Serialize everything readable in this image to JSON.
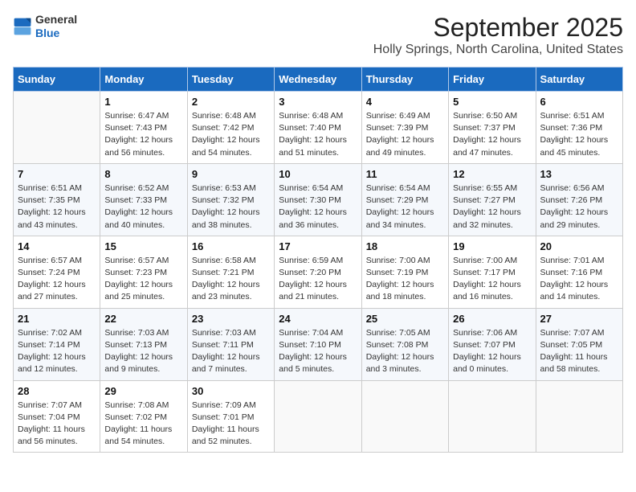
{
  "header": {
    "logo_line1": "General",
    "logo_line2": "Blue",
    "month": "September 2025",
    "location": "Holly Springs, North Carolina, United States"
  },
  "weekdays": [
    "Sunday",
    "Monday",
    "Tuesday",
    "Wednesday",
    "Thursday",
    "Friday",
    "Saturday"
  ],
  "weeks": [
    [
      {
        "day": "",
        "info": ""
      },
      {
        "day": "1",
        "info": "Sunrise: 6:47 AM\nSunset: 7:43 PM\nDaylight: 12 hours\nand 56 minutes."
      },
      {
        "day": "2",
        "info": "Sunrise: 6:48 AM\nSunset: 7:42 PM\nDaylight: 12 hours\nand 54 minutes."
      },
      {
        "day": "3",
        "info": "Sunrise: 6:48 AM\nSunset: 7:40 PM\nDaylight: 12 hours\nand 51 minutes."
      },
      {
        "day": "4",
        "info": "Sunrise: 6:49 AM\nSunset: 7:39 PM\nDaylight: 12 hours\nand 49 minutes."
      },
      {
        "day": "5",
        "info": "Sunrise: 6:50 AM\nSunset: 7:37 PM\nDaylight: 12 hours\nand 47 minutes."
      },
      {
        "day": "6",
        "info": "Sunrise: 6:51 AM\nSunset: 7:36 PM\nDaylight: 12 hours\nand 45 minutes."
      }
    ],
    [
      {
        "day": "7",
        "info": "Sunrise: 6:51 AM\nSunset: 7:35 PM\nDaylight: 12 hours\nand 43 minutes."
      },
      {
        "day": "8",
        "info": "Sunrise: 6:52 AM\nSunset: 7:33 PM\nDaylight: 12 hours\nand 40 minutes."
      },
      {
        "day": "9",
        "info": "Sunrise: 6:53 AM\nSunset: 7:32 PM\nDaylight: 12 hours\nand 38 minutes."
      },
      {
        "day": "10",
        "info": "Sunrise: 6:54 AM\nSunset: 7:30 PM\nDaylight: 12 hours\nand 36 minutes."
      },
      {
        "day": "11",
        "info": "Sunrise: 6:54 AM\nSunset: 7:29 PM\nDaylight: 12 hours\nand 34 minutes."
      },
      {
        "day": "12",
        "info": "Sunrise: 6:55 AM\nSunset: 7:27 PM\nDaylight: 12 hours\nand 32 minutes."
      },
      {
        "day": "13",
        "info": "Sunrise: 6:56 AM\nSunset: 7:26 PM\nDaylight: 12 hours\nand 29 minutes."
      }
    ],
    [
      {
        "day": "14",
        "info": "Sunrise: 6:57 AM\nSunset: 7:24 PM\nDaylight: 12 hours\nand 27 minutes."
      },
      {
        "day": "15",
        "info": "Sunrise: 6:57 AM\nSunset: 7:23 PM\nDaylight: 12 hours\nand 25 minutes."
      },
      {
        "day": "16",
        "info": "Sunrise: 6:58 AM\nSunset: 7:21 PM\nDaylight: 12 hours\nand 23 minutes."
      },
      {
        "day": "17",
        "info": "Sunrise: 6:59 AM\nSunset: 7:20 PM\nDaylight: 12 hours\nand 21 minutes."
      },
      {
        "day": "18",
        "info": "Sunrise: 7:00 AM\nSunset: 7:19 PM\nDaylight: 12 hours\nand 18 minutes."
      },
      {
        "day": "19",
        "info": "Sunrise: 7:00 AM\nSunset: 7:17 PM\nDaylight: 12 hours\nand 16 minutes."
      },
      {
        "day": "20",
        "info": "Sunrise: 7:01 AM\nSunset: 7:16 PM\nDaylight: 12 hours\nand 14 minutes."
      }
    ],
    [
      {
        "day": "21",
        "info": "Sunrise: 7:02 AM\nSunset: 7:14 PM\nDaylight: 12 hours\nand 12 minutes."
      },
      {
        "day": "22",
        "info": "Sunrise: 7:03 AM\nSunset: 7:13 PM\nDaylight: 12 hours\nand 9 minutes."
      },
      {
        "day": "23",
        "info": "Sunrise: 7:03 AM\nSunset: 7:11 PM\nDaylight: 12 hours\nand 7 minutes."
      },
      {
        "day": "24",
        "info": "Sunrise: 7:04 AM\nSunset: 7:10 PM\nDaylight: 12 hours\nand 5 minutes."
      },
      {
        "day": "25",
        "info": "Sunrise: 7:05 AM\nSunset: 7:08 PM\nDaylight: 12 hours\nand 3 minutes."
      },
      {
        "day": "26",
        "info": "Sunrise: 7:06 AM\nSunset: 7:07 PM\nDaylight: 12 hours\nand 0 minutes."
      },
      {
        "day": "27",
        "info": "Sunrise: 7:07 AM\nSunset: 7:05 PM\nDaylight: 11 hours\nand 58 minutes."
      }
    ],
    [
      {
        "day": "28",
        "info": "Sunrise: 7:07 AM\nSunset: 7:04 PM\nDaylight: 11 hours\nand 56 minutes."
      },
      {
        "day": "29",
        "info": "Sunrise: 7:08 AM\nSunset: 7:02 PM\nDaylight: 11 hours\nand 54 minutes."
      },
      {
        "day": "30",
        "info": "Sunrise: 7:09 AM\nSunset: 7:01 PM\nDaylight: 11 hours\nand 52 minutes."
      },
      {
        "day": "",
        "info": ""
      },
      {
        "day": "",
        "info": ""
      },
      {
        "day": "",
        "info": ""
      },
      {
        "day": "",
        "info": ""
      }
    ]
  ]
}
